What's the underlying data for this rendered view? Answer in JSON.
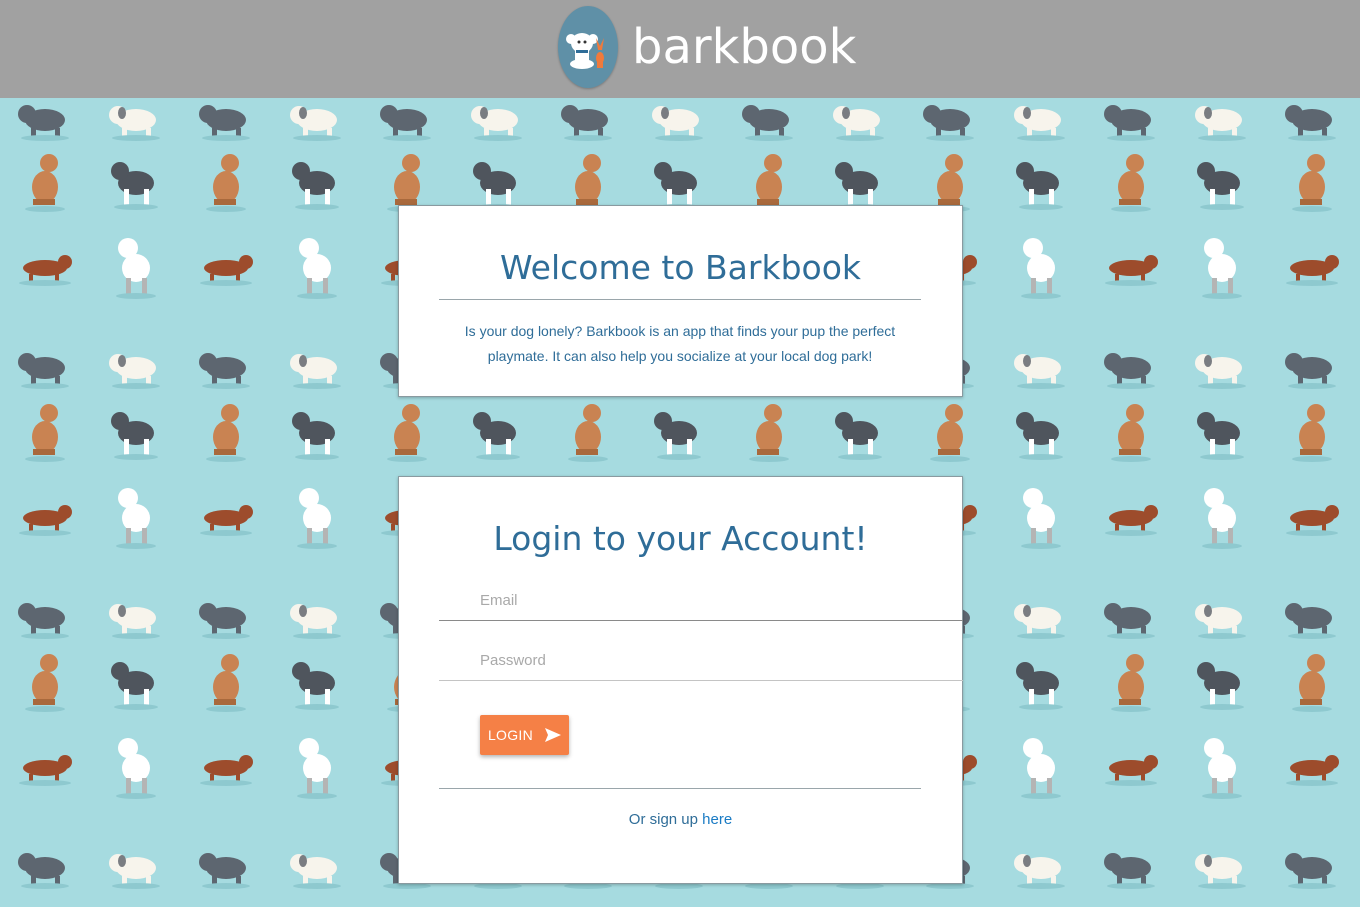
{
  "brand": {
    "name": "barkbook",
    "logo_icon": "dog-logo-icon"
  },
  "welcome": {
    "title": "Welcome to Barkbook",
    "description": "Is your dog lonely? Barkbook is an app that finds your pup the perfect playmate. It can also help you socialize at your local dog park!"
  },
  "login": {
    "title": "Login to your Account!",
    "email_placeholder": "Email",
    "password_placeholder": "Password",
    "button_label": "LOGIN",
    "button_icon": "send-arrow-icon",
    "signup_prefix": "Or sign up",
    "signup_link": "here"
  },
  "colors": {
    "header": "#a1a1a1",
    "background": "#a6dbe0",
    "accent": "#f58046",
    "title": "#2f6d98"
  }
}
